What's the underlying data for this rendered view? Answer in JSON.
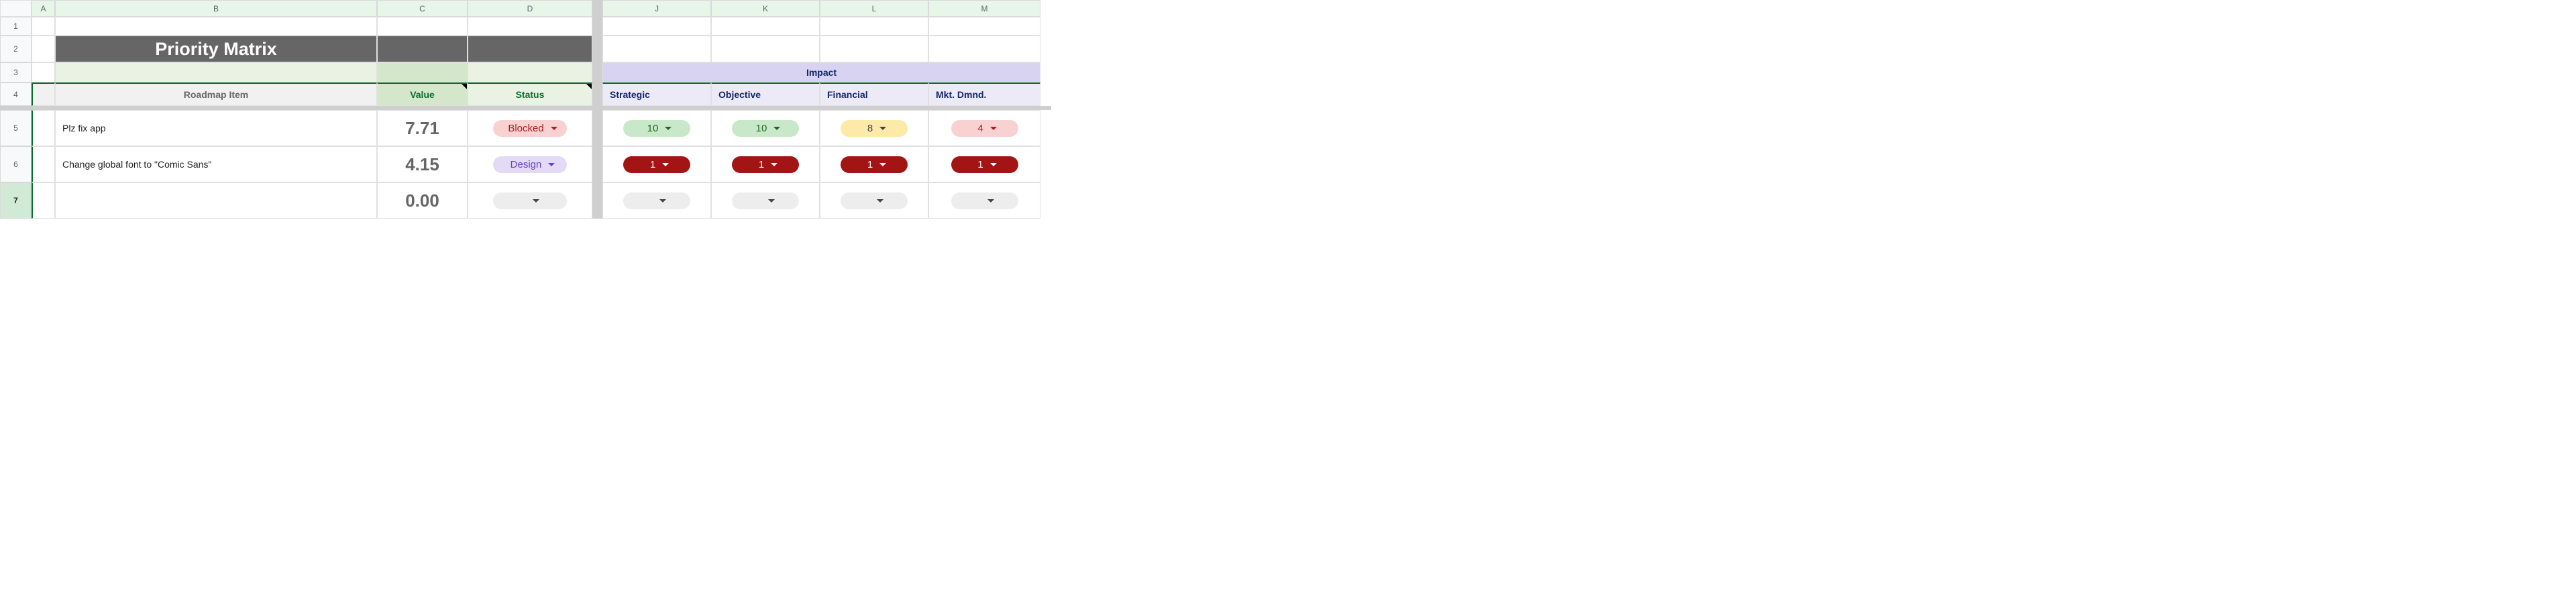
{
  "columns": {
    "a": "A",
    "b": "B",
    "c": "C",
    "d": "D",
    "j": "J",
    "k": "K",
    "l": "L",
    "m": "M"
  },
  "rowNums": {
    "r1": "1",
    "r2": "2",
    "r3": "3",
    "r4": "4",
    "r5": "5",
    "r6": "6",
    "r7": "7"
  },
  "title": "Priority Matrix",
  "groupHeader": {
    "impact": "Impact"
  },
  "headers": {
    "roadmap": "Roadmap Item",
    "value": "Value",
    "status": "Status",
    "strategic": "Strategic",
    "objective": "Objective",
    "financial": "Financial",
    "mktdmnd": "Mkt. Dmnd."
  },
  "rows": [
    {
      "item": "Plz fix app",
      "value": "7.71",
      "status": {
        "label": "Blocked",
        "class": "chip-blocked"
      },
      "strategic": {
        "label": "10",
        "class": "chip-10"
      },
      "objective": {
        "label": "10",
        "class": "chip-10"
      },
      "financial": {
        "label": "8",
        "class": "chip-8"
      },
      "mktdmnd": {
        "label": "4",
        "class": "chip-4"
      }
    },
    {
      "item": "Change global font to \"Comic Sans\"",
      "value": "4.15",
      "status": {
        "label": "Design",
        "class": "chip-design"
      },
      "strategic": {
        "label": "1",
        "class": "chip-1"
      },
      "objective": {
        "label": "1",
        "class": "chip-1"
      },
      "financial": {
        "label": "1",
        "class": "chip-1"
      },
      "mktdmnd": {
        "label": "1",
        "class": "chip-1"
      }
    },
    {
      "item": "",
      "value": "0.00",
      "status": {
        "label": "",
        "class": "chip-empty"
      },
      "strategic": {
        "label": "",
        "class": "chip-empty"
      },
      "objective": {
        "label": "",
        "class": "chip-empty"
      },
      "financial": {
        "label": "",
        "class": "chip-empty"
      },
      "mktdmnd": {
        "label": "",
        "class": "chip-empty"
      }
    }
  ]
}
